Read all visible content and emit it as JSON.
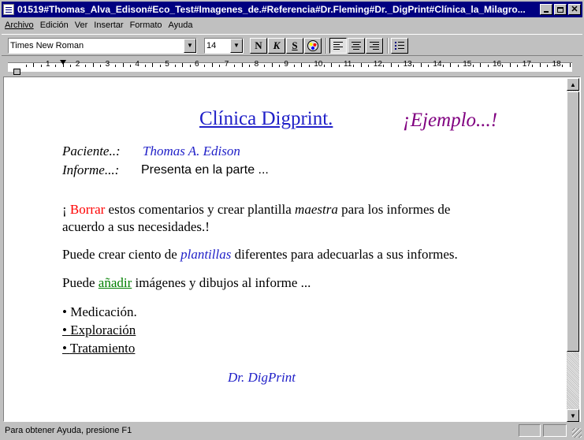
{
  "window": {
    "title": "01519#Thomas_Alva_Edison#Eco_Test#Imagenes_de.#Referencia#Dr.Fleming#Dr._DigPrint#Clínica_la_Milagro..."
  },
  "menu": {
    "items": [
      "Archivo",
      "Edición",
      "Ver",
      "Insertar",
      "Formato",
      "Ayuda"
    ]
  },
  "toolbar": {
    "font_name": "Times New Roman",
    "font_size": "14",
    "bold_label": "N",
    "italic_label": "K",
    "underline_label": "S"
  },
  "ruler": {
    "numbers": [
      "1",
      "2",
      "3",
      "4",
      "5",
      "6",
      "7",
      "8",
      "9",
      "10",
      "11",
      "12",
      "13",
      "14",
      "15",
      "16",
      "17",
      "18"
    ]
  },
  "document": {
    "header_title": "Clínica Digprint.",
    "header_example": "¡Ejemplo...!",
    "patient_label": "Paciente..:",
    "patient_value": "Thomas A. Edison",
    "report_label": "Informe...:",
    "report_value": "Presenta en la parte ...",
    "para1_start": "¡ ",
    "para1_red": "Borrar",
    "para1_mid": " estos comentarios y crear plantilla ",
    "para1_italic": "maestra",
    "para1_end": " para los informes de",
    "para1_line2": "acuerdo a sus necesidades.!",
    "para2_start": "Puede crear ciento de ",
    "para2_blue": "plantillas",
    "para2_end": " diferentes para adecuarlas a sus informes.",
    "para3_start": "Puede ",
    "para3_green": "añadir",
    "para3_end": " imágenes y dibujos al informe ...",
    "bullets": [
      "Medicación.",
      "Exploración",
      "Tratamiento"
    ],
    "signature": "Dr. DigPrint"
  },
  "colors": {
    "blue": "#2020c8",
    "purple": "#800080",
    "red": "#ff0000",
    "green": "#008000"
  },
  "status": {
    "help_text": "Para obtener Ayuda, presione F1"
  }
}
